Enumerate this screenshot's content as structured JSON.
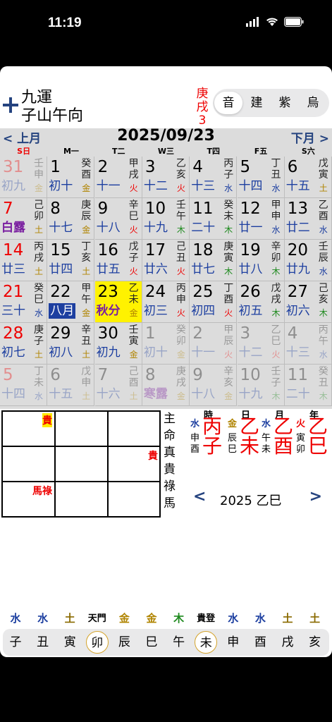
{
  "status": {
    "time": "11:19"
  },
  "header": {
    "luck": "九運",
    "mountain": "子山午向",
    "day_pillar": "庚戌",
    "day_num": "3",
    "tabs": [
      {
        "label": "音"
      },
      {
        "label": "建"
      },
      {
        "label": "紫"
      },
      {
        "label": "烏"
      }
    ]
  },
  "calendar": {
    "prev": "< 上月",
    "next": "下月 >",
    "date": "2025/09/23",
    "weekdays": [
      "S日",
      "M一",
      "T二",
      "W三",
      "T四",
      "F五",
      "S六"
    ],
    "rows": [
      [
        {
          "n": "31",
          "l": "初九",
          "g": [
            "壬",
            "申"
          ],
          "w": "金",
          "wc": "#b08400",
          "dim": true,
          "lc": "#1d3fa0",
          "nc": "#e00"
        },
        {
          "n": "1",
          "l": "初十",
          "g": [
            "癸",
            "酉"
          ],
          "w": "金",
          "wc": "#b08400",
          "lc": "#1d3fa0"
        },
        {
          "n": "2",
          "l": "十一",
          "g": [
            "甲",
            "戌"
          ],
          "w": "火",
          "wc": "#e00",
          "lc": "#1d3fa0"
        },
        {
          "n": "3",
          "l": "十二",
          "g": [
            "乙",
            "亥"
          ],
          "w": "火",
          "wc": "#e00",
          "lc": "#1d3fa0"
        },
        {
          "n": "4",
          "l": "十三",
          "g": [
            "丙",
            "子"
          ],
          "w": "水",
          "wc": "#1d3fa0",
          "lc": "#1d3fa0"
        },
        {
          "n": "5",
          "l": "十四",
          "g": [
            "丁",
            "丑"
          ],
          "w": "水",
          "wc": "#1d3fa0",
          "lc": "#1d3fa0"
        },
        {
          "n": "6",
          "l": "十五",
          "g": [
            "戊",
            "寅"
          ],
          "w": "土",
          "wc": "#b08400",
          "lc": "#1d3fa0"
        }
      ],
      [
        {
          "n": "7",
          "l": "白露",
          "g": [
            "己",
            "卯"
          ],
          "w": "土",
          "wc": "#b08400",
          "lc": "#7a1fa0",
          "nc": "#e00",
          "term": true
        },
        {
          "n": "8",
          "l": "十七",
          "g": [
            "庚",
            "辰"
          ],
          "w": "金",
          "wc": "#b08400",
          "lc": "#1d3fa0"
        },
        {
          "n": "9",
          "l": "十八",
          "g": [
            "辛",
            "巳"
          ],
          "w": "火",
          "wc": "#e00",
          "lc": "#1d3fa0"
        },
        {
          "n": "10",
          "l": "十九",
          "g": [
            "壬",
            "午"
          ],
          "w": "木",
          "wc": "#1f8a1f",
          "lc": "#1d3fa0"
        },
        {
          "n": "11",
          "l": "二十",
          "g": [
            "癸",
            "未"
          ],
          "w": "木",
          "wc": "#1f8a1f",
          "lc": "#1d3fa0"
        },
        {
          "n": "12",
          "l": "廿一",
          "g": [
            "甲",
            "申"
          ],
          "w": "水",
          "wc": "#1d3fa0",
          "lc": "#1d3fa0"
        },
        {
          "n": "13",
          "l": "廿二",
          "g": [
            "乙",
            "酉"
          ],
          "w": "水",
          "wc": "#1d3fa0",
          "lc": "#1d3fa0"
        }
      ],
      [
        {
          "n": "14",
          "l": "廿三",
          "g": [
            "丙",
            "戌"
          ],
          "w": "土",
          "wc": "#b08400",
          "lc": "#1d3fa0",
          "nc": "#e00"
        },
        {
          "n": "15",
          "l": "廿四",
          "g": [
            "丁",
            "亥"
          ],
          "w": "土",
          "wc": "#b08400",
          "lc": "#1d3fa0"
        },
        {
          "n": "16",
          "l": "廿五",
          "g": [
            "戊",
            "子"
          ],
          "w": "火",
          "wc": "#e00",
          "lc": "#1d3fa0"
        },
        {
          "n": "17",
          "l": "廿六",
          "g": [
            "己",
            "丑"
          ],
          "w": "火",
          "wc": "#e00",
          "lc": "#1d3fa0"
        },
        {
          "n": "18",
          "l": "廿七",
          "g": [
            "庚",
            "寅"
          ],
          "w": "木",
          "wc": "#1f8a1f",
          "lc": "#1d3fa0"
        },
        {
          "n": "19",
          "l": "廿八",
          "g": [
            "辛",
            "卯"
          ],
          "w": "木",
          "wc": "#1f8a1f",
          "lc": "#1d3fa0"
        },
        {
          "n": "20",
          "l": "廿九",
          "g": [
            "壬",
            "辰"
          ],
          "w": "水",
          "wc": "#1d3fa0",
          "lc": "#1d3fa0"
        }
      ],
      [
        {
          "n": "21",
          "l": "三十",
          "g": [
            "癸",
            "巳"
          ],
          "w": "水",
          "wc": "#1d3fa0",
          "lc": "#1d3fa0",
          "nc": "#e00"
        },
        {
          "n": "22",
          "l": "八月",
          "g": [
            "甲",
            "午"
          ],
          "w": "金",
          "wc": "#b08400",
          "lc": "#fff",
          "lbg": "#1d3fa0"
        },
        {
          "n": "23",
          "l": "秋分",
          "g": [
            "乙",
            "未"
          ],
          "w": "金",
          "wc": "#b08400",
          "lc": "#7a1fa0",
          "today": true,
          "term": true
        },
        {
          "n": "24",
          "l": "初三",
          "g": [
            "丙",
            "申"
          ],
          "w": "火",
          "wc": "#e00",
          "lc": "#1d3fa0"
        },
        {
          "n": "25",
          "l": "初四",
          "g": [
            "丁",
            "酉"
          ],
          "w": "火",
          "wc": "#e00",
          "lc": "#1d3fa0"
        },
        {
          "n": "26",
          "l": "初五",
          "g": [
            "戊",
            "戌"
          ],
          "w": "木",
          "wc": "#1f8a1f",
          "lc": "#1d3fa0"
        },
        {
          "n": "27",
          "l": "初六",
          "g": [
            "己",
            "亥"
          ],
          "w": "木",
          "wc": "#1f8a1f",
          "lc": "#1d3fa0"
        }
      ],
      [
        {
          "n": "28",
          "l": "初七",
          "g": [
            "庚",
            "子"
          ],
          "w": "土",
          "wc": "#b08400",
          "lc": "#1d3fa0",
          "nc": "#e00"
        },
        {
          "n": "29",
          "l": "初八",
          "g": [
            "辛",
            "丑"
          ],
          "w": "土",
          "wc": "#b08400",
          "lc": "#1d3fa0"
        },
        {
          "n": "30",
          "l": "初九",
          "g": [
            "壬",
            "寅"
          ],
          "w": "金",
          "wc": "#b08400",
          "lc": "#1d3fa0"
        },
        {
          "n": "1",
          "l": "初十",
          "g": [
            "癸",
            "卯"
          ],
          "w": "金",
          "wc": "#b08400",
          "lc": "#1d3fa0",
          "dim": true
        },
        {
          "n": "2",
          "l": "十一",
          "g": [
            "甲",
            "辰"
          ],
          "w": "火",
          "wc": "#e00",
          "lc": "#1d3fa0",
          "dim": true
        },
        {
          "n": "3",
          "l": "十二",
          "g": [
            "乙",
            "巳"
          ],
          "w": "火",
          "wc": "#e00",
          "lc": "#1d3fa0",
          "dim": true
        },
        {
          "n": "4",
          "l": "十三",
          "g": [
            "丙",
            "午"
          ],
          "w": "水",
          "wc": "#1d3fa0",
          "lc": "#1d3fa0",
          "dim": true
        }
      ],
      [
        {
          "n": "5",
          "l": "十四",
          "g": [
            "丁",
            "未"
          ],
          "w": "水",
          "wc": "#1d3fa0",
          "lc": "#1d3fa0",
          "dim": true,
          "nc": "#e00"
        },
        {
          "n": "6",
          "l": "十五",
          "g": [
            "戊",
            "申"
          ],
          "w": "土",
          "wc": "#b08400",
          "lc": "#1d3fa0",
          "dim": true
        },
        {
          "n": "7",
          "l": "十六",
          "g": [
            "己",
            "酉"
          ],
          "w": "土",
          "wc": "#b08400",
          "lc": "#1d3fa0",
          "dim": true
        },
        {
          "n": "8",
          "l": "寒露",
          "g": [
            "庚",
            "戌"
          ],
          "w": "金",
          "wc": "#b08400",
          "lc": "#7a1fa0",
          "dim": true,
          "term": true
        },
        {
          "n": "9",
          "l": "十八",
          "g": [
            "辛",
            "亥"
          ],
          "w": "金",
          "wc": "#b08400",
          "lc": "#1d3fa0",
          "dim": true
        },
        {
          "n": "10",
          "l": "十九",
          "g": [
            "壬",
            "子"
          ],
          "w": "木",
          "wc": "#1f8a1f",
          "lc": "#1d3fa0",
          "dim": true
        },
        {
          "n": "11",
          "l": "二十",
          "g": [
            "癸",
            "丑"
          ],
          "w": "木",
          "wc": "#1f8a1f",
          "lc": "#1d3fa0",
          "dim": true
        }
      ]
    ]
  },
  "box": {
    "gui1": "貴",
    "gui2": "貴",
    "malu": "馬祿"
  },
  "labels": [
    "主",
    "命",
    "真",
    "貴",
    "祿",
    "馬"
  ],
  "pillars": [
    {
      "head": "時",
      "el": "水",
      "stem": "丙",
      "branch": "子",
      "hidden": [
        "申",
        "酉"
      ],
      "ec": "#1d3fa0"
    },
    {
      "head": "日",
      "el": "金",
      "stem": "乙",
      "branch": "未",
      "hidden": [
        "辰",
        "巳"
      ],
      "ec": "#b08400"
    },
    {
      "head": "月",
      "el": "水",
      "stem": "乙",
      "branch": "酉",
      "hidden": [
        "午",
        "未"
      ],
      "ec": "#1d3fa0"
    },
    {
      "head": "年",
      "el": "火",
      "stem": "乙",
      "branch": "巳",
      "hidden": [
        "寅",
        "卯"
      ],
      "ec": "#e00"
    }
  ],
  "year": {
    "prev": "<",
    "label": "2025 乙巳",
    "next": ">"
  },
  "bottom": {
    "elements": [
      {
        "t": "水",
        "c": "#1d3fa0"
      },
      {
        "t": "水",
        "c": "#1d3fa0"
      },
      {
        "t": "土",
        "c": "#8a6a00"
      },
      {
        "t": "天門",
        "c": "#000"
      },
      {
        "t": "金",
        "c": "#b08400"
      },
      {
        "t": "金",
        "c": "#b08400"
      },
      {
        "t": "木",
        "c": "#1f8a1f"
      },
      {
        "t": "貴登",
        "c": "#000"
      },
      {
        "t": "水",
        "c": "#1d3fa0"
      },
      {
        "t": "水",
        "c": "#1d3fa0"
      },
      {
        "t": "土",
        "c": "#8a6a00"
      },
      {
        "t": "土",
        "c": "#8a6a00"
      }
    ],
    "branches": [
      {
        "t": "子"
      },
      {
        "t": "丑"
      },
      {
        "t": "寅"
      },
      {
        "t": "卯",
        "circ": true
      },
      {
        "t": "辰"
      },
      {
        "t": "巳"
      },
      {
        "t": "午"
      },
      {
        "t": "未",
        "circ": true
      },
      {
        "t": "申"
      },
      {
        "t": "酉"
      },
      {
        "t": "戌"
      },
      {
        "t": "亥"
      }
    ]
  }
}
